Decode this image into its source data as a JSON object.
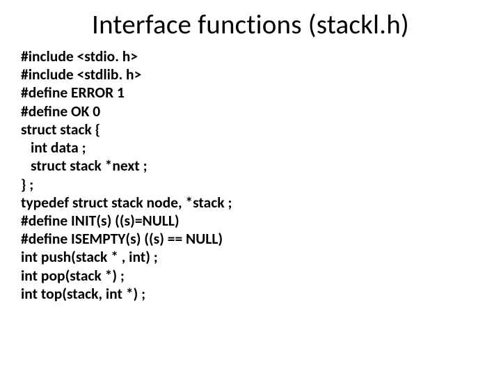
{
  "title": "Interface functions (stackl.h)",
  "code": {
    "l1": "#include <stdio. h>",
    "l2": "#include <stdlib. h>",
    "l3": "#define ERROR 1",
    "l4": "#define OK 0",
    "l5": "struct stack {",
    "l6": "int data ;",
    "l7": "struct stack *next ;",
    "l8": "} ;",
    "l9": "typedef struct stack node, *stack ;",
    "l10": "#define INIT(s) ((s)=NULL)",
    "l11": "#define ISEMPTY(s) ((s) == NULL)",
    "l12": "int push(stack * , int) ;",
    "l13": "int pop(stack *) ;",
    "l14": "int top(stack, int *) ;"
  }
}
